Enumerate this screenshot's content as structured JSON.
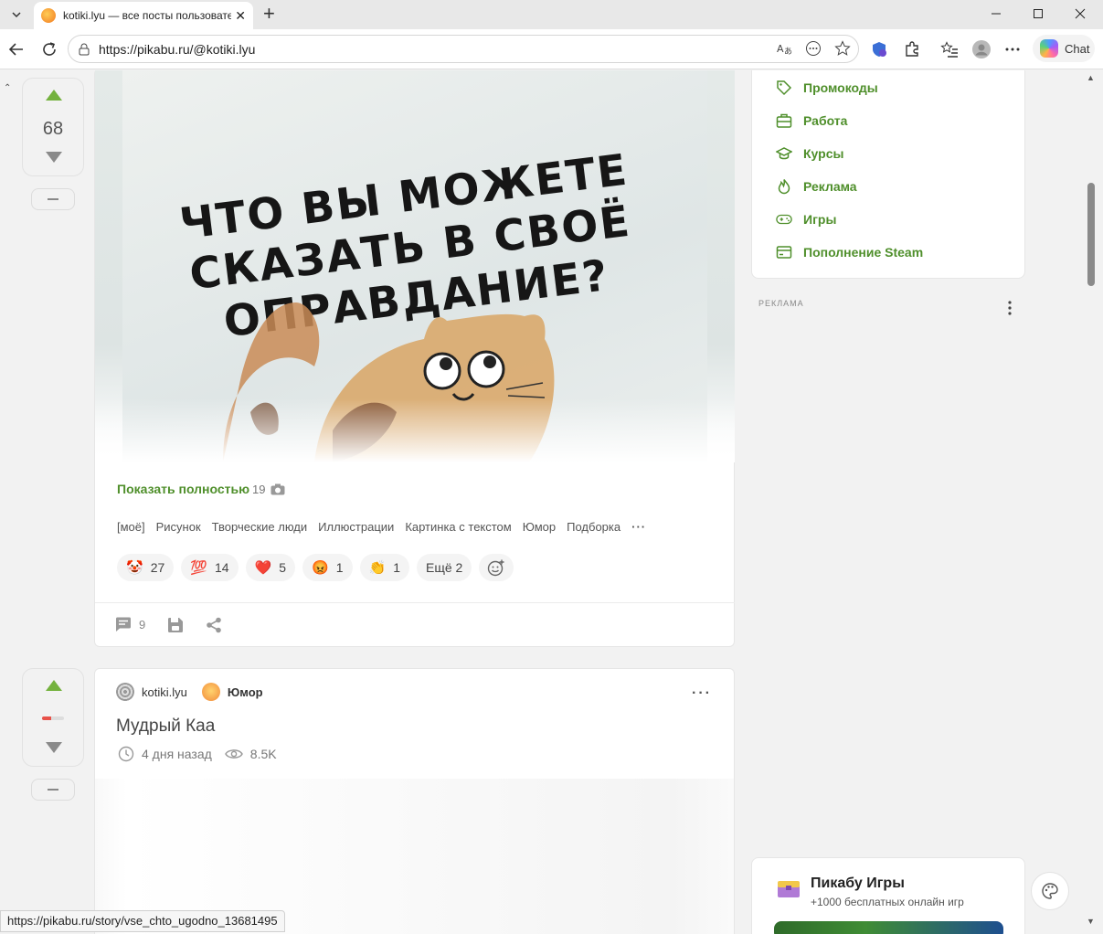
{
  "browser": {
    "tab_title": "kotiki.lyu — все посты пользовател",
    "url": "https://pikabu.ru/@kotiki.lyu",
    "chat_label": "Chat",
    "status_url": "https://pikabu.ru/story/vse_chto_ugodno_13681495"
  },
  "post1": {
    "rating": "68",
    "image_caption": "ЧТО ВЫ МОЖЕТЕ СКАЗАТЬ В СВОЁ ОПРАВДАНИЕ?",
    "show_full_label": "Показать полностью",
    "image_count": "19",
    "tags": [
      "[моё]",
      "Рисунок",
      "Творческие люди",
      "Иллюстрации",
      "Картинка с текстом",
      "Юмор",
      "Подборка"
    ],
    "reactions": [
      {
        "emoji": "🤡",
        "count": "27"
      },
      {
        "emoji": "💯",
        "count": "14"
      },
      {
        "emoji": "❤️",
        "count": "5"
      },
      {
        "emoji": "😡",
        "count": "1"
      },
      {
        "emoji": "👏",
        "count": "1"
      }
    ],
    "more_reactions_label": "Ещё 2",
    "comments_count": "9"
  },
  "post2": {
    "author": "kotiki.lyu",
    "community": "Юмор",
    "title": "Мудрый Каа",
    "time_ago": "4 дня назад",
    "views": "8.5K",
    "rating_fraction": 0.4
  },
  "sidebar": {
    "menu": [
      {
        "label": "Промокоды",
        "icon": "tag-icon"
      },
      {
        "label": "Работа",
        "icon": "briefcase-icon"
      },
      {
        "label": "Курсы",
        "icon": "graduation-cap-icon"
      },
      {
        "label": "Реклама",
        "icon": "flame-icon"
      },
      {
        "label": "Игры",
        "icon": "gamepad-icon"
      },
      {
        "label": "Пополнение Steam",
        "icon": "wallet-icon"
      }
    ],
    "ad_label": "РЕКЛАМА",
    "games_title": "Пикабу Игры",
    "games_subtitle": "+1000 бесплатных онлайн игр"
  },
  "colors": {
    "accent_green": "#4f8f2b",
    "vote_green": "#74b23e"
  }
}
